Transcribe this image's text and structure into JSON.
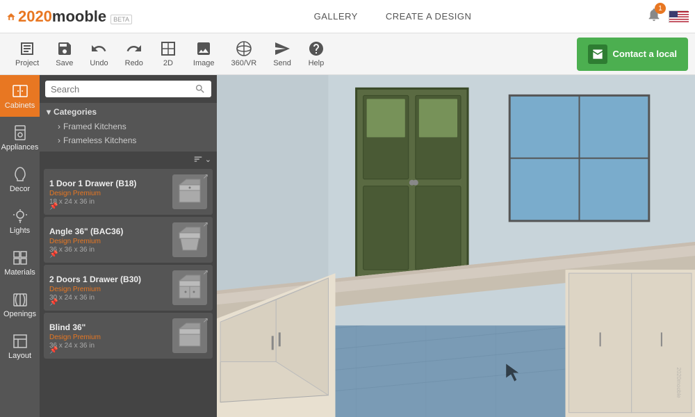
{
  "app": {
    "title": "2020mooble",
    "beta": "BETA"
  },
  "header": {
    "nav": [
      {
        "label": "GALLERY",
        "id": "gallery"
      },
      {
        "label": "CREATE A DESIGN",
        "id": "create-design"
      }
    ],
    "notification_count": "1"
  },
  "toolbar": {
    "items": [
      {
        "id": "project",
        "label": "Project"
      },
      {
        "id": "save",
        "label": "Save"
      },
      {
        "id": "undo",
        "label": "Undo"
      },
      {
        "id": "redo",
        "label": "Redo"
      },
      {
        "id": "2d",
        "label": "2D"
      },
      {
        "id": "image",
        "label": "Image"
      },
      {
        "id": "360vr",
        "label": "360/VR"
      },
      {
        "id": "send",
        "label": "Send"
      },
      {
        "id": "help",
        "label": "Help"
      }
    ],
    "contact_btn": "Contact a local"
  },
  "sidebar": {
    "items": [
      {
        "id": "cabinets",
        "label": "Cabinets",
        "active": true
      },
      {
        "id": "appliances",
        "label": "Appliances",
        "active": false
      },
      {
        "id": "decor",
        "label": "Decor",
        "active": false
      },
      {
        "id": "lights",
        "label": "Lights",
        "active": false
      },
      {
        "id": "materials",
        "label": "Materials",
        "active": false
      },
      {
        "id": "openings",
        "label": "Openings",
        "active": false
      },
      {
        "id": "layout",
        "label": "Layout",
        "active": false
      }
    ]
  },
  "panel": {
    "search_placeholder": "Search",
    "categories_label": "Categories",
    "categories": [
      {
        "label": "Framed Kitchens"
      },
      {
        "label": "Frameless Kitchens"
      }
    ],
    "items": [
      {
        "name": "1 Door 1 Drawer (B18)",
        "badge": "Design Premium",
        "size": "18 x 24 x 36 in"
      },
      {
        "name": "Angle 36\" (BAC36)",
        "badge": "Design Premium",
        "size": "36 x 36 x 36 in"
      },
      {
        "name": "2 Doors 1 Drawer (B30)",
        "badge": "Design Premium",
        "size": "30 x 24 x 36 in"
      },
      {
        "name": "Blind 36\"",
        "badge": "Design Premium",
        "size": "36 x 24 x 36 in"
      }
    ]
  }
}
